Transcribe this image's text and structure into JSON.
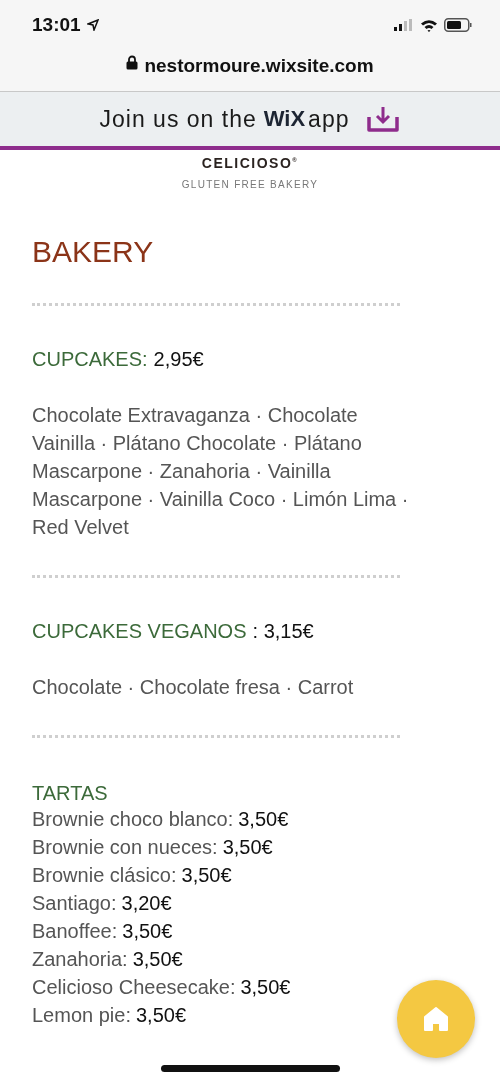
{
  "status_bar": {
    "time": "13:01"
  },
  "browser": {
    "url": "nestormoure.wixsite.com"
  },
  "banner": {
    "text": "Join us on the",
    "logo": "WiX",
    "suffix": "app"
  },
  "brand": {
    "name": "CELICIOSO",
    "mark": "®",
    "tagline": "GLUTEN FREE BAKERY"
  },
  "page_title": "BAKERY",
  "sections": [
    {
      "kind": "description",
      "title": "CUPCAKES:",
      "price": "2,95€",
      "text": "Chocolate Extravaganza · Chocolate Vainilla · Plátano Chocolate · Plátano Mascarpone · Zanahoria · Vainilla Mascarpone  · Vainilla Coco · Limón Lima · Red Velvet"
    },
    {
      "kind": "description",
      "title": "CUPCAKES VEGANOS",
      "price": ": 3,15€",
      "text": "Chocolate · Chocolate fresa · Carrot"
    },
    {
      "kind": "list",
      "title": "TARTAS",
      "items": [
        {
          "name": "Brownie choco blanco:",
          "price": "3,50€"
        },
        {
          "name": "Brownie con nueces:",
          "price": "3,50€"
        },
        {
          "name": "Brownie clásico:",
          "price": "3,50€"
        },
        {
          "name": "Santiago:",
          "price": "3,20€"
        },
        {
          "name": "Banoffee:",
          "price": "3,50€"
        },
        {
          "name": "Zanahoria:",
          "price": "3,50€"
        },
        {
          "name": "Celicioso Cheesecake:",
          "price": "3,50€"
        },
        {
          "name": "Lemon pie:",
          "price": "3,50€"
        }
      ]
    }
  ]
}
